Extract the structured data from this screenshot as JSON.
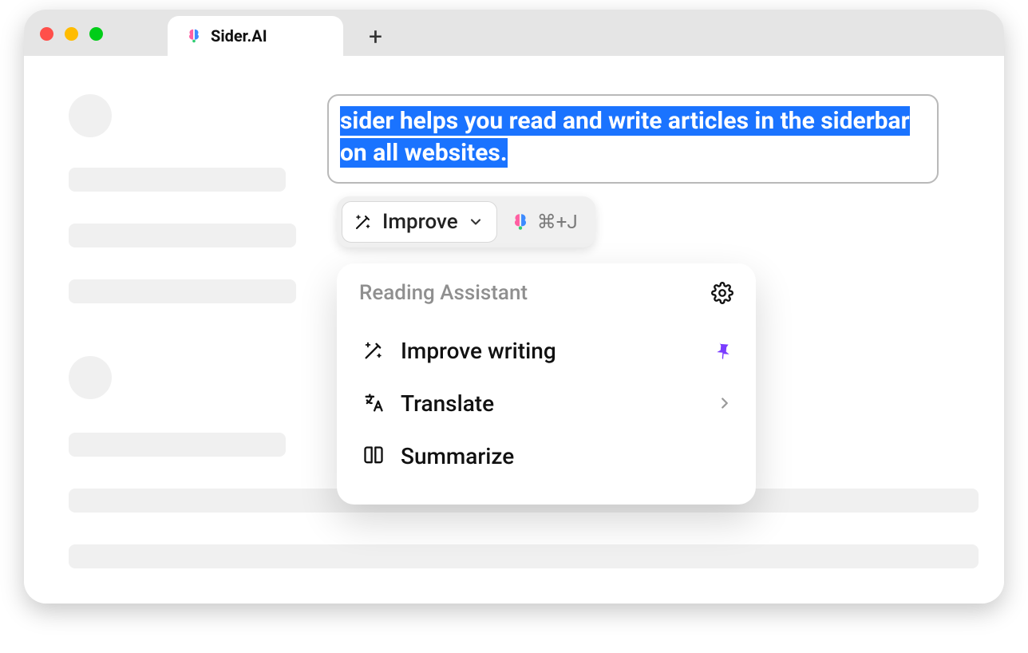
{
  "tab": {
    "title": "Sider.AI"
  },
  "editor": {
    "selected_text": "sider helps you read and write articles in the siderbar on all websites."
  },
  "toolbar": {
    "action_label": "Improve",
    "shortcut": "⌘+J"
  },
  "dropdown": {
    "title": "Reading Assistant",
    "items": [
      {
        "label": "Improve writing",
        "icon": "sparkle-wand",
        "pinned": true,
        "has_submenu": false
      },
      {
        "label": "Translate",
        "icon": "translate",
        "pinned": false,
        "has_submenu": true
      },
      {
        "label": "Summarize",
        "icon": "book-open",
        "pinned": false,
        "has_submenu": false
      }
    ]
  }
}
